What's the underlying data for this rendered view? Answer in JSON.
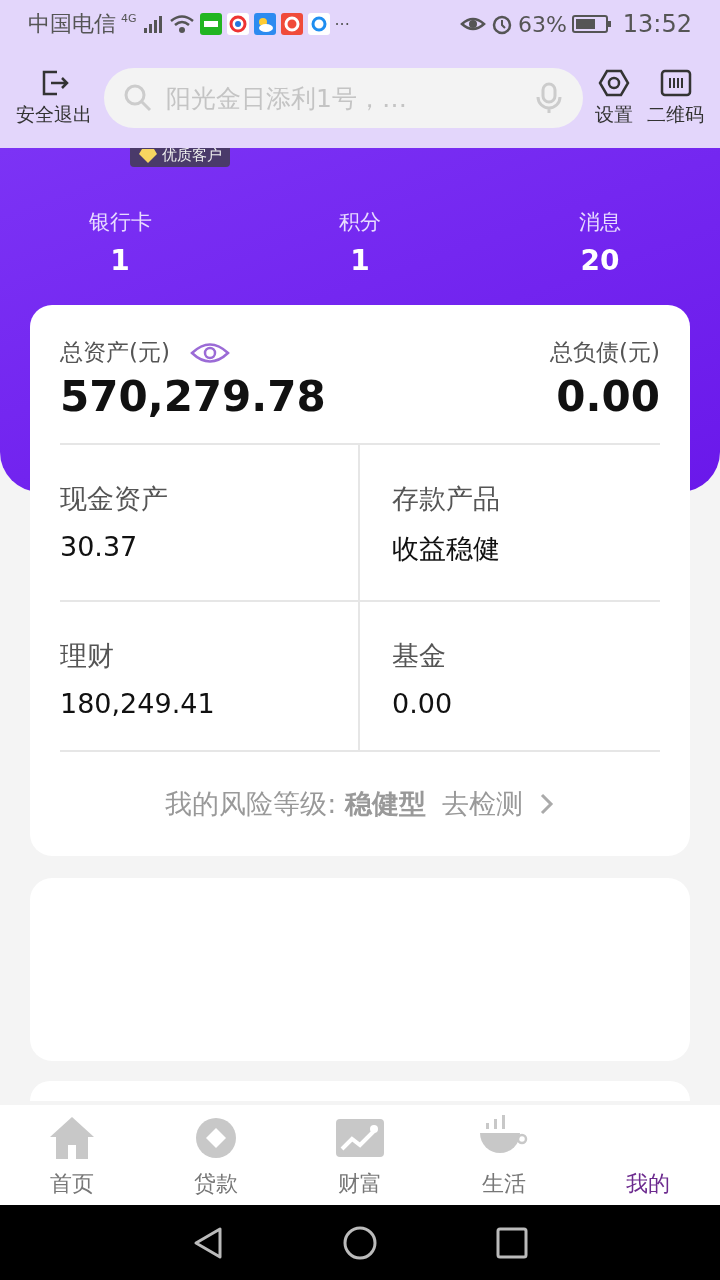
{
  "status_bar": {
    "carrier": "中国电信",
    "network": "4G",
    "more": "···",
    "battery": "63%",
    "time": "13:52"
  },
  "header": {
    "logout": "安全退出",
    "search": {
      "placeholder": "阳光金日添利1号，…"
    },
    "settings": "设置",
    "qrcode": "二维码"
  },
  "badge": "优质客户",
  "stats": [
    {
      "label": "银行卡",
      "value": "1"
    },
    {
      "label": "积分",
      "value": "1"
    },
    {
      "label": "消息",
      "value": "20"
    }
  ],
  "assets": {
    "total_label": "总资产(元)",
    "total": "570,279.78",
    "debt_label": "总负债(元)",
    "debt": "0.00",
    "items": [
      {
        "label": "现金资产",
        "value": "30.37"
      },
      {
        "label": "存款产品",
        "value": "收益稳健"
      },
      {
        "label": "理财",
        "value": "180,249.41"
      },
      {
        "label": "基金",
        "value": "0.00"
      }
    ],
    "risk": "我的风险等级: **稳健型**",
    "risk_link": "去检测"
  },
  "tabs": [
    {
      "label": "首页",
      "selected": false
    },
    {
      "label": "贷款",
      "selected": false
    },
    {
      "label": "财富",
      "selected": false
    },
    {
      "label": "生活",
      "selected": false
    },
    {
      "label": "我的",
      "selected": true
    }
  ]
}
